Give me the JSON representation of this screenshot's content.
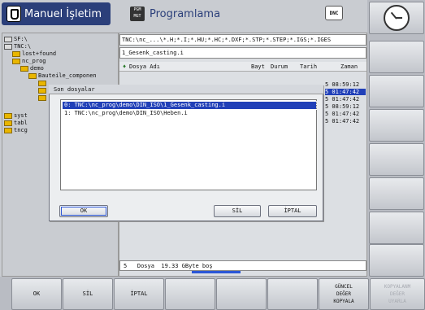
{
  "header": {
    "mode_label": "Manuel İşletim",
    "program_label": "Programlama",
    "program_icon_text": "PGM MGT",
    "dnc_label": "DNC"
  },
  "tree": {
    "items": [
      {
        "label": "SF:\\",
        "type": "drive"
      },
      {
        "label": "TNC:\\",
        "type": "drive"
      },
      {
        "label": "lost+found",
        "type": "folder"
      },
      {
        "label": "nc_prog",
        "type": "folder"
      },
      {
        "label": "demo",
        "type": "folder"
      },
      {
        "label": "Bauteile_componen",
        "type": "folder"
      },
      {
        "label": "",
        "type": "folder"
      },
      {
        "label": "",
        "type": "folder"
      },
      {
        "label": "",
        "type": "folder"
      },
      {
        "label": "syst",
        "type": "folder"
      },
      {
        "label": "tabl",
        "type": "folder"
      },
      {
        "label": "tncg",
        "type": "folder"
      }
    ]
  },
  "files": {
    "path": "TNC:\\nc_...\\*.H;*.I;*.HU;*.HC;*.DXF;*.STP;*.STEP;*.IGS;*.IGES",
    "filename": "1_Gesenk_casting.i",
    "columns": {
      "name": "Dosya Adı",
      "bytes": "Bayt",
      "status": "Durum",
      "date": "Tarih",
      "time": "Zaman"
    },
    "times": [
      "5 08:59:12",
      "5 01:47:42",
      "5 01:47:42",
      "5 08:59:12",
      "5 01:47:42",
      "5 01:47:42"
    ],
    "status_line": "5   Dosya  19.33 GByte boş"
  },
  "dialog": {
    "title": "Son dosyalar",
    "items": [
      "0: TNC:\\nc_prog\\demo\\DIN_ISO\\1_Gesenk_casting.i",
      "1: TNC:\\nc_prog\\demo\\DIN_ISO\\Heben.i"
    ],
    "ok_label": "OK",
    "delete_label": "SİL",
    "cancel_label": "İPTAL"
  },
  "softkeys": {
    "ok": "OK",
    "delete": "SİL",
    "cancel": "İPTAL",
    "update": "GÜNCEL\nDEĞER\nKOPYALA",
    "copy_disabled": "KOPYALANM\nDEĞER\nUYARLA"
  }
}
